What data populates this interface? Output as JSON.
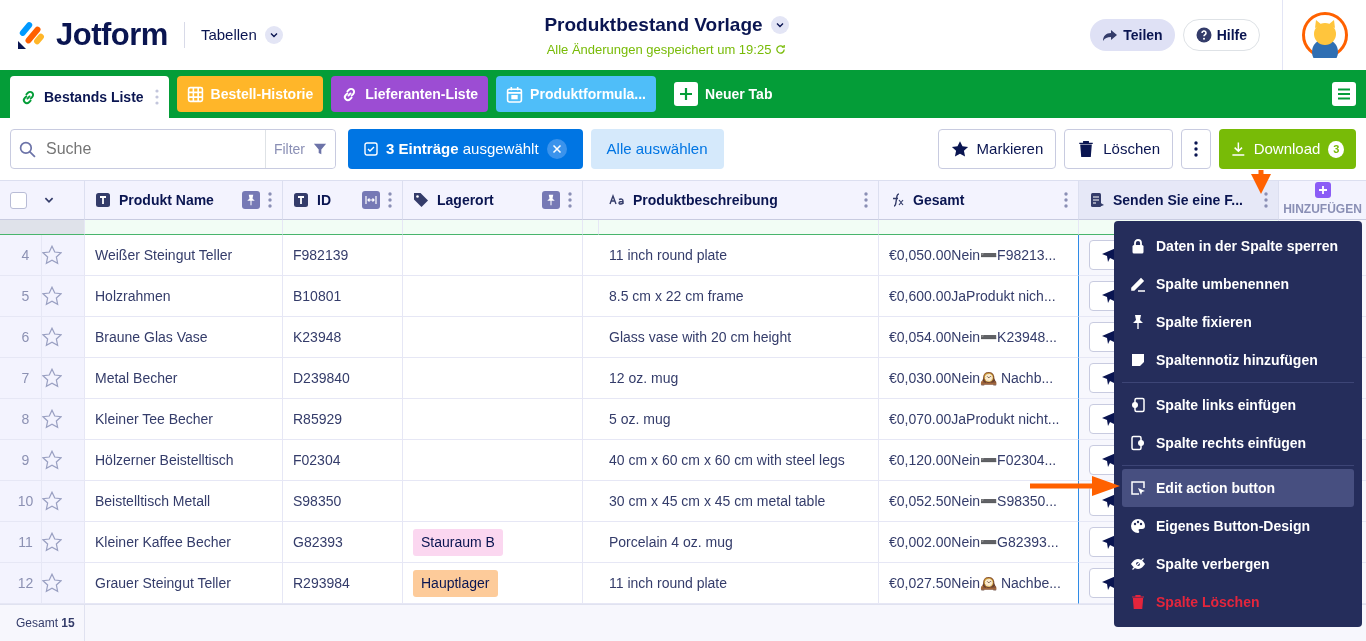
{
  "header": {
    "brand": "Jotform",
    "section": "Tabellen",
    "title": "Produktbestand Vorlage",
    "save_status": "Alle Änderungen gespeichert um 19:25",
    "actions": [
      {
        "label": "Teilen",
        "kind": "share"
      },
      {
        "label": "Hilfe",
        "kind": "help"
      }
    ]
  },
  "tabs": [
    {
      "label": "Bestands Liste",
      "kind": "link",
      "color": "#ffffff",
      "selected": true
    },
    {
      "label": "Bestell-Historie",
      "kind": "grid",
      "color": "#ffb629",
      "selected": false
    },
    {
      "label": "Lieferanten-Liste",
      "kind": "link",
      "color": "#9c4dd3",
      "selected": false
    },
    {
      "label": "Produktformula...",
      "kind": "calendar",
      "color": "#4fbef9",
      "selected": false
    }
  ],
  "new_tab": "Neuer Tab",
  "toolbar": {
    "search_placeholder": "Suche",
    "filter": "Filter",
    "selection": "**3 Einträge** ausgewählt",
    "select_all": "Alle auswählen",
    "buttons": [
      {
        "label": "Markieren",
        "kind": "star"
      },
      {
        "label": "Löschen",
        "kind": "trash"
      }
    ],
    "download": "Download",
    "download_count": "3"
  },
  "header_checkbox": {
    "checked": false
  },
  "columns": [
    {
      "label": "Produkt Name",
      "kind": "text",
      "pinned": true,
      "auto_width": false
    },
    {
      "label": "ID",
      "kind": "text",
      "pinned": false,
      "auto_width": true
    },
    {
      "label": "Lagerort",
      "kind": "tag",
      "pinned": true,
      "auto_width": false
    },
    {
      "kind": "blank",
      "pinned": false,
      "auto_width": false
    },
    {
      "label": "Produktbeschreibung",
      "kind": "longtext",
      "pinned": false,
      "auto_width": false
    },
    {
      "label": "Gesamt",
      "kind": "formula",
      "pinned": false,
      "auto_width": false
    },
    {
      "label": "Senden Sie eine F...",
      "kind": "form",
      "pinned": false,
      "auto_width": false
    }
  ],
  "add_column": "HINZUFÜGEN",
  "rows": [
    {
      "number": "4",
      "starred": false,
      "name": "Weißer Steingut Teller",
      "id": "F982139",
      "description": "11 inch round plate",
      "total": "€0,050.00Nein➖F98213..."
    },
    {
      "number": "5",
      "starred": false,
      "name": "Holzrahmen",
      "id": "B10801",
      "description": "8.5 cm x 22 cm frame",
      "total": "€0,600.00JaProdukt nich..."
    },
    {
      "number": "6",
      "starred": false,
      "name": "Braune Glas Vase",
      "id": "K23948",
      "description": "Glass vase with 20 cm height",
      "total": "€0,054.00Nein➖K23948..."
    },
    {
      "number": "7",
      "starred": false,
      "name": "Metal Becher",
      "id": "D239840",
      "description": "12 oz. mug",
      "total": "€0,030.00Nein🕰️ Nachb..."
    },
    {
      "number": "8",
      "starred": false,
      "name": "Kleiner Tee Becher",
      "id": "R85929",
      "description": "5 oz. mug",
      "total": "€0,070.00JaProdukt nicht..."
    },
    {
      "number": "9",
      "starred": false,
      "name": "Hölzerner Beistelltisch",
      "id": "F02304",
      "description": "40 cm x 60 cm x 60 cm with steel legs",
      "total": "€0,120.00Nein➖F02304..."
    },
    {
      "number": "10",
      "starred": false,
      "name": "Beistelltisch Metall",
      "id": "S98350",
      "description": "30 cm x 45 cm x 45 cm metal table",
      "total": "€0,052.50Nein➖S98350..."
    },
    {
      "number": "11",
      "starred": false,
      "name": "Kleiner Kaffee Becher",
      "id": "G82393",
      "location": {
        "text": "Stauraum B",
        "color": "#fbd7f0"
      },
      "description": "Porcelain 4 oz. mug",
      "total": "€0,002.00Nein➖G82393..."
    },
    {
      "number": "12",
      "starred": false,
      "name": "Grauer Steingut Teller",
      "id": "R293984",
      "location": {
        "text": "Hauptlager",
        "color": "#fdcb9a"
      },
      "description": "11 inch round plate",
      "total": "€0,027.50Nein🕰️ Nachbe..."
    }
  ],
  "footer": "Gesamt **15**",
  "menu": [
    [
      {
        "label": "Daten in der Spalte sperren",
        "kind": "lock",
        "selected": false,
        "danger": false
      },
      {
        "label": "Spalte umbenennen",
        "kind": "pencil",
        "selected": false,
        "danger": false
      },
      {
        "label": "Spalte fixieren",
        "kind": "pin",
        "selected": false,
        "danger": false
      },
      {
        "label": "Spaltennotiz hinzufügen",
        "kind": "note",
        "selected": false,
        "danger": false
      }
    ],
    [
      {
        "label": "Spalte links einfügen",
        "kind": "insert-left",
        "selected": false,
        "danger": false
      },
      {
        "label": "Spalte rechts einfügen",
        "kind": "insert-right",
        "selected": false,
        "danger": false
      }
    ],
    [
      {
        "label": "Edit action button",
        "kind": "cursor",
        "selected": true,
        "danger": false
      },
      {
        "label": "Eigenes Button-Design",
        "kind": "palette",
        "selected": false,
        "danger": false
      },
      {
        "label": "Spalte verbergen",
        "kind": "eye-off",
        "selected": false,
        "danger": false
      },
      {
        "label": "Spalte Löschen",
        "kind": "trash",
        "selected": false,
        "danger": true
      }
    ]
  ]
}
